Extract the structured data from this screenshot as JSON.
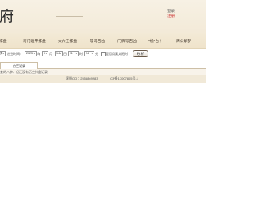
{
  "header": {
    "logo_text": "府",
    "login_label": "登录",
    "register_label": "注册"
  },
  "nav": {
    "items": [
      {
        "label": "排盘"
      },
      {
        "label": "奇门遁甲排盘"
      },
      {
        "label": "大六壬排盘"
      },
      {
        "label": "号码吉凶"
      },
      {
        "label": "门牌号吉凶"
      },
      {
        "label": "\"机\"占卜"
      },
      {
        "label": "周公解梦"
      }
    ]
  },
  "form": {
    "gender_value": "男",
    "birth_time_label": "出生时间:",
    "year_value": "2025",
    "year_unit": "年",
    "month_value": "9",
    "month_unit": "月",
    "day_value": "14",
    "day_unit": "日",
    "hour_value": "11",
    "hour_unit": "时",
    "minute_value": "34",
    "minute_unit": "分",
    "solar_time_label": "是否用真太阳时",
    "solar_time_checked": false,
    "submit_label": "分 析"
  },
  "history": {
    "tab_label": "历史记录",
    "empty_text": "查的八字，但还没有历史排盘记录"
  },
  "footer": {
    "contact": "客服QQ：2558869983",
    "icp": "ICP备17007805号-1"
  }
}
